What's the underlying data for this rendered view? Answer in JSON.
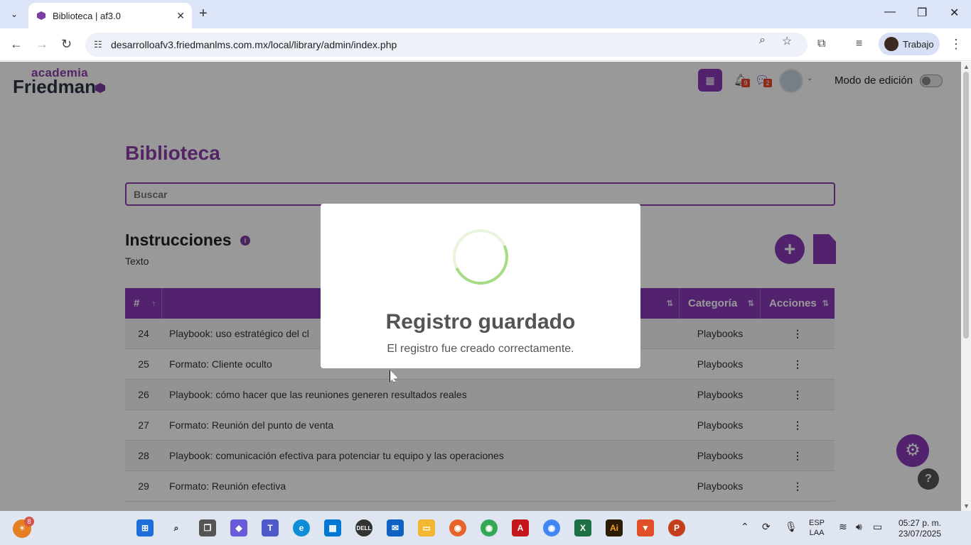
{
  "browser": {
    "tab_title": "Biblioteca | af3.0",
    "url": "desarrolloafv3.friedmanlms.com.mx/local/library/admin/index.php",
    "profile_name": "Trabajo"
  },
  "header": {
    "logo_top": "academia",
    "logo_bottom": "Friedman",
    "notifications_count": "9",
    "messages_count": "2",
    "edit_mode_label": "Modo de edición"
  },
  "page": {
    "title": "Biblioteca",
    "search_placeholder": "Buscar",
    "section_title": "Instrucciones",
    "section_text": "Texto"
  },
  "table": {
    "headers": {
      "num": "#",
      "title": "",
      "category": "Categoría",
      "actions": "Acciones"
    },
    "rows": [
      {
        "num": "24",
        "title": "Playbook: uso estratégico del cl",
        "category": "Playbooks",
        "actions": "⋮"
      },
      {
        "num": "25",
        "title": "Formato: Cliente oculto",
        "category": "Playbooks",
        "actions": "⋮"
      },
      {
        "num": "26",
        "title": "Playbook: cómo hacer que las reuniones generen resultados reales",
        "category": "Playbooks",
        "actions": "⋮"
      },
      {
        "num": "27",
        "title": "Formato: Reunión del punto de venta",
        "category": "Playbooks",
        "actions": "⋮"
      },
      {
        "num": "28",
        "title": "Playbook: comunicación efectiva para potenciar tu equipo y las operaciones",
        "category": "Playbooks",
        "actions": "⋮"
      },
      {
        "num": "29",
        "title": "Formato: Reunión efectiva",
        "category": "Playbooks",
        "actions": "⋮"
      }
    ]
  },
  "modal": {
    "title": "Registro guardado",
    "text": "El registro fue creado correctamente."
  },
  "taskbar": {
    "weather_badge": "8",
    "lang_line1": "ESP",
    "lang_line2": "LAA",
    "time": "05:27 p. m.",
    "date": "23/07/2025"
  },
  "colors": {
    "brand_purple": "#8a3ab9",
    "success_green": "#a5dc86"
  }
}
